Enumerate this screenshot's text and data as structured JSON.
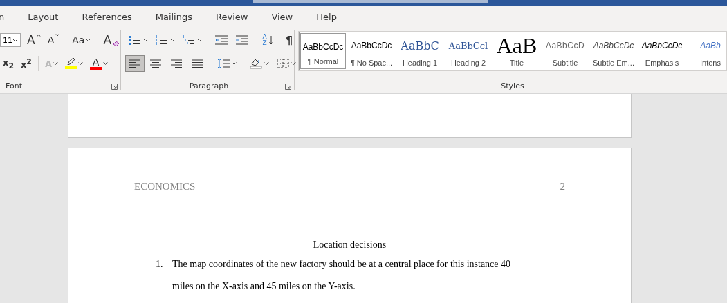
{
  "tabs": [
    {
      "label": "n",
      "selected": false
    },
    {
      "label": "Layout",
      "selected": false
    },
    {
      "label": "References",
      "selected": false
    },
    {
      "label": "Mailings",
      "selected": false
    },
    {
      "label": "Review",
      "selected": false
    },
    {
      "label": "View",
      "selected": false
    },
    {
      "label": "Help",
      "selected": false
    }
  ],
  "font_group": {
    "label": "Font",
    "font_size": "11",
    "row1": [
      {
        "kind": "grow",
        "glyph": "A"
      },
      {
        "kind": "shrink",
        "glyph": "A"
      },
      {
        "kind": "sep"
      },
      {
        "kind": "case",
        "glyph": "Aa",
        "dropdown": true
      },
      {
        "kind": "sep"
      },
      {
        "kind": "clear",
        "glyph": "A"
      }
    ],
    "row2": [
      {
        "kind": "script",
        "glyph": "x$_{2}$"
      },
      {
        "kind": "script",
        "glyph": "x$^{2}$"
      },
      {
        "kind": "sep"
      },
      {
        "kind": "effects",
        "glyph": "A",
        "dropdown": true,
        "disabled": true
      },
      {
        "kind": "highlight",
        "dropdown": true,
        "color": "#ffff00"
      },
      {
        "kind": "fontcolor",
        "glyph": "A",
        "dropdown": true,
        "color": "#ff0000"
      }
    ]
  },
  "paragraph_group": {
    "label": "Paragraph",
    "row1": [
      {
        "kind": "bullets",
        "dropdown": true
      },
      {
        "kind": "numbering",
        "dropdown": true
      },
      {
        "kind": "multilevel",
        "dropdown": true
      },
      {
        "kind": "sep"
      },
      {
        "kind": "outdent"
      },
      {
        "kind": "indent"
      },
      {
        "kind": "sep"
      },
      {
        "kind": "sort",
        "glyph": "AZ"
      },
      {
        "kind": "sep"
      },
      {
        "kind": "pilcrow",
        "glyph": "¶"
      }
    ],
    "row2": [
      {
        "kind": "align-left",
        "selected": true
      },
      {
        "kind": "align-center",
        "selected": false
      },
      {
        "kind": "align-right",
        "selected": false
      },
      {
        "kind": "justify",
        "selected": false
      },
      {
        "kind": "sep"
      },
      {
        "kind": "spacing",
        "dropdown": true
      },
      {
        "kind": "sep"
      },
      {
        "kind": "shading",
        "dropdown": true
      },
      {
        "kind": "borders",
        "dropdown": true
      }
    ]
  },
  "styles_group": {
    "label": "Styles",
    "items": [
      {
        "kind": "normal",
        "preview": "AaBbCcDc",
        "label": "¶ Normal",
        "selected": true
      },
      {
        "kind": "normal",
        "preview": "AaBbCcDc",
        "label": "¶ No Spac...",
        "selected": false
      },
      {
        "kind": "heading1",
        "preview": "AaBbC",
        "label": "Heading 1",
        "selected": false
      },
      {
        "kind": "heading2",
        "preview": "AaBbCcl",
        "label": "Heading 2",
        "selected": false
      },
      {
        "kind": "title",
        "preview": "AaB",
        "label": "Title",
        "selected": false
      },
      {
        "kind": "subtitle",
        "preview": "AaBbCcD",
        "label": "Subtitle",
        "selected": false
      },
      {
        "kind": "subtle",
        "preview": "AaBbCcDc",
        "label": "Subtle Em...",
        "selected": false
      },
      {
        "kind": "emphasis",
        "preview": "AaBbCcDc",
        "label": "Emphasis",
        "selected": false
      },
      {
        "kind": "intense",
        "preview": "AaBb",
        "label": "Intens",
        "selected": false
      }
    ]
  },
  "document": {
    "header": "ECONOMICS",
    "page_number": "2",
    "heading": "Location decisions",
    "list": [
      {
        "marker": "1.",
        "text": "The map coordinates of the new factory should be at a central place for this instance 40 miles on the X-axis and 45 miles on the Y-axis."
      }
    ]
  }
}
